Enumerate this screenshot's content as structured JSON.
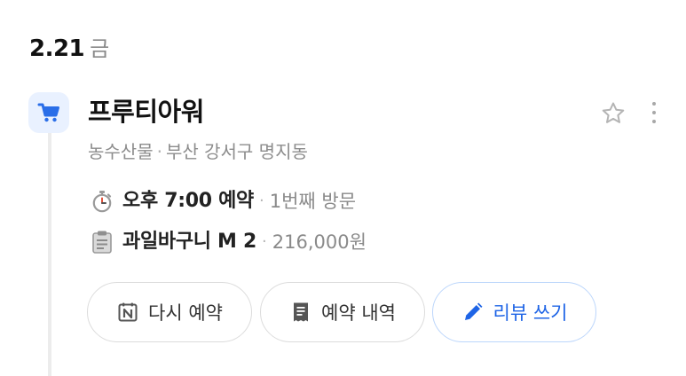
{
  "header": {
    "date": "2.21",
    "weekday": "금"
  },
  "place": {
    "name": "프루티아워",
    "category": "농수산물",
    "separator": "·",
    "location": "부산 강서구 명지동",
    "icon": "shopping-cart-icon"
  },
  "reservation": {
    "time_label": "오후 7:00 예약",
    "separator": "·",
    "visit_label": "1번째 방문",
    "time_icon": "stopwatch-icon"
  },
  "order": {
    "item_label": "과일바구니 M 2",
    "separator": "·",
    "price": "216,000원",
    "order_icon": "clipboard-icon"
  },
  "actions": {
    "rebook_label": "다시 예약",
    "history_label": "예약 내역",
    "review_label": "리뷰 쓰기"
  },
  "colors": {
    "accent": "#1e64e6",
    "icon_bg": "#e9f1ff",
    "muted": "#8a8a8a"
  }
}
